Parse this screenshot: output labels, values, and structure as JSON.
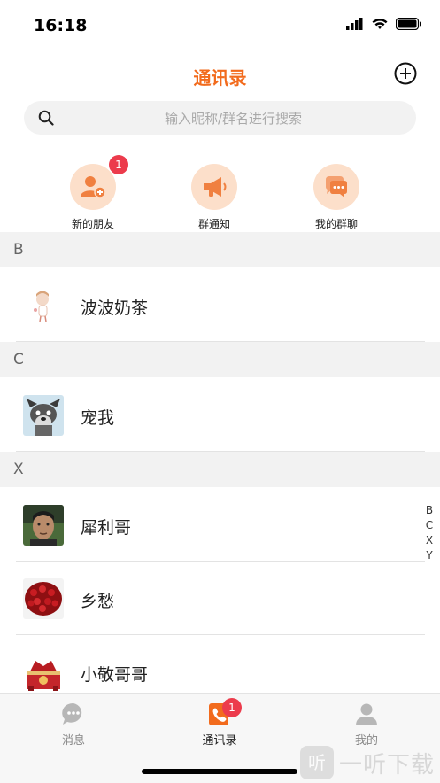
{
  "status": {
    "time": "16:18"
  },
  "header": {
    "title": "通讯录"
  },
  "search": {
    "placeholder": "输入昵称/群名进行搜索"
  },
  "quick_actions": [
    {
      "label": "新的朋友",
      "icon": "add-friend-icon",
      "badge": "1"
    },
    {
      "label": "群通知",
      "icon": "megaphone-icon"
    },
    {
      "label": "我的群聊",
      "icon": "group-chat-icon"
    }
  ],
  "sections": [
    {
      "letter": "B",
      "contacts": [
        {
          "name": "波波奶茶"
        }
      ]
    },
    {
      "letter": "C",
      "contacts": [
        {
          "name": "宠我"
        }
      ]
    },
    {
      "letter": "X",
      "contacts": [
        {
          "name": "犀利哥"
        },
        {
          "name": "乡愁"
        },
        {
          "name": "小敬哥哥"
        }
      ]
    }
  ],
  "index_letters": [
    "B",
    "C",
    "X",
    "Y"
  ],
  "tabbar": {
    "tabs": [
      {
        "label": "消息",
        "icon": "message-icon"
      },
      {
        "label": "通讯录",
        "icon": "contacts-icon",
        "badge": "1",
        "active": true
      },
      {
        "label": "我的",
        "icon": "profile-icon"
      }
    ]
  },
  "watermark": {
    "text": "一听下载",
    "logo": "听"
  },
  "colors": {
    "accent": "#f26b1d",
    "badge": "#ec3b4c",
    "section_bg": "#f2f2f2",
    "icon_bg": "#fcdfca"
  }
}
